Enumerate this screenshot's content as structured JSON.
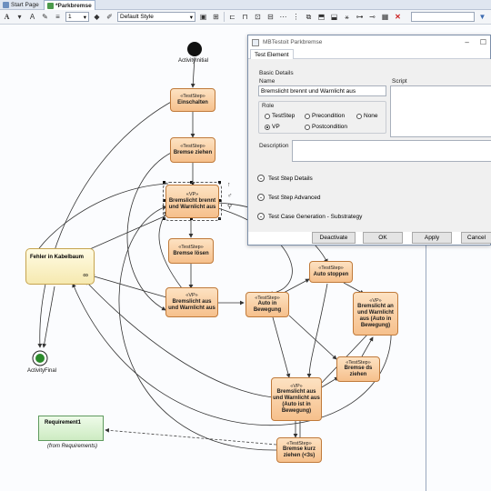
{
  "tabs": [
    {
      "label": "Start Page",
      "active": false
    },
    {
      "label": "*Parkbremse",
      "active": true
    }
  ],
  "toolbar": {
    "font_label": "A",
    "line_width_value": "1",
    "style_select": "Default Style"
  },
  "diagram": {
    "initial_label": "ActivityInitial",
    "final_label": "ActivityFinal",
    "nodes": [
      {
        "id": "einschalten",
        "stereotype": "«TestStep»",
        "label": "Einschalten"
      },
      {
        "id": "bremse-ziehen",
        "stereotype": "«TestStep»",
        "label": "Bremse ziehen"
      },
      {
        "id": "bremslicht-brennt",
        "stereotype": "«VP»",
        "label": "Bremslicht brennt und Warnlicht aus"
      },
      {
        "id": "bremse-loesen",
        "stereotype": "«TestStep»",
        "label": "Bremse lösen"
      },
      {
        "id": "bremslicht-aus",
        "stereotype": "«VP»",
        "label": "Bremslicht aus und Warnlicht aus"
      },
      {
        "id": "auto-in-bewegung",
        "stereotype": "«TestStep»",
        "label": "Auto in Bewegung"
      },
      {
        "id": "auto-stoppen",
        "stereotype": "«TestStep»",
        "label": "Auto stoppen"
      },
      {
        "id": "bremslicht-an",
        "stereotype": "«VP»",
        "label": "Bremslicht an und Warnlicht aus (Auto in Bewegung)"
      },
      {
        "id": "bremse-ds-ziehen",
        "stereotype": "«TestStep»",
        "label": "Bremse ds ziehen"
      },
      {
        "id": "bremslicht-aus-bewegung",
        "stereotype": "«VP»",
        "label": "Bremslicht aus und Warnlicht aus (Auto ist in Bewegung)"
      },
      {
        "id": "bremse-kurz",
        "stereotype": "«TestStep»",
        "label": "Bremse kurz ziehen (<3s)"
      }
    ],
    "fehler_label": "Fehler in Kabelbaum",
    "requirement_label": "Requirement1",
    "requirement_source": "(from Requirements)"
  },
  "dialog": {
    "title": "MBTestoit Parkbremse",
    "tab_label": "Test Element",
    "basic_details_label": "Basic Details",
    "name_label": "Name",
    "name_value": "Bremslicht brennt und Warnlicht aus",
    "script_label": "Script",
    "role_label": "Role",
    "roles": [
      {
        "label": "TestStep",
        "checked": false
      },
      {
        "label": "Precondition",
        "checked": false
      },
      {
        "label": "None",
        "checked": false
      },
      {
        "label": "VP",
        "checked": true
      },
      {
        "label": "Postcondition",
        "checked": false
      }
    ],
    "description_label": "Description",
    "expanders": [
      "Test Step Details",
      "Test Step Advanced",
      "Test Case Generation - Substrategy"
    ],
    "buttons": {
      "deactivate": "Deactivate",
      "ok": "OK",
      "apply": "Apply",
      "cancel": "Cancel"
    }
  }
}
